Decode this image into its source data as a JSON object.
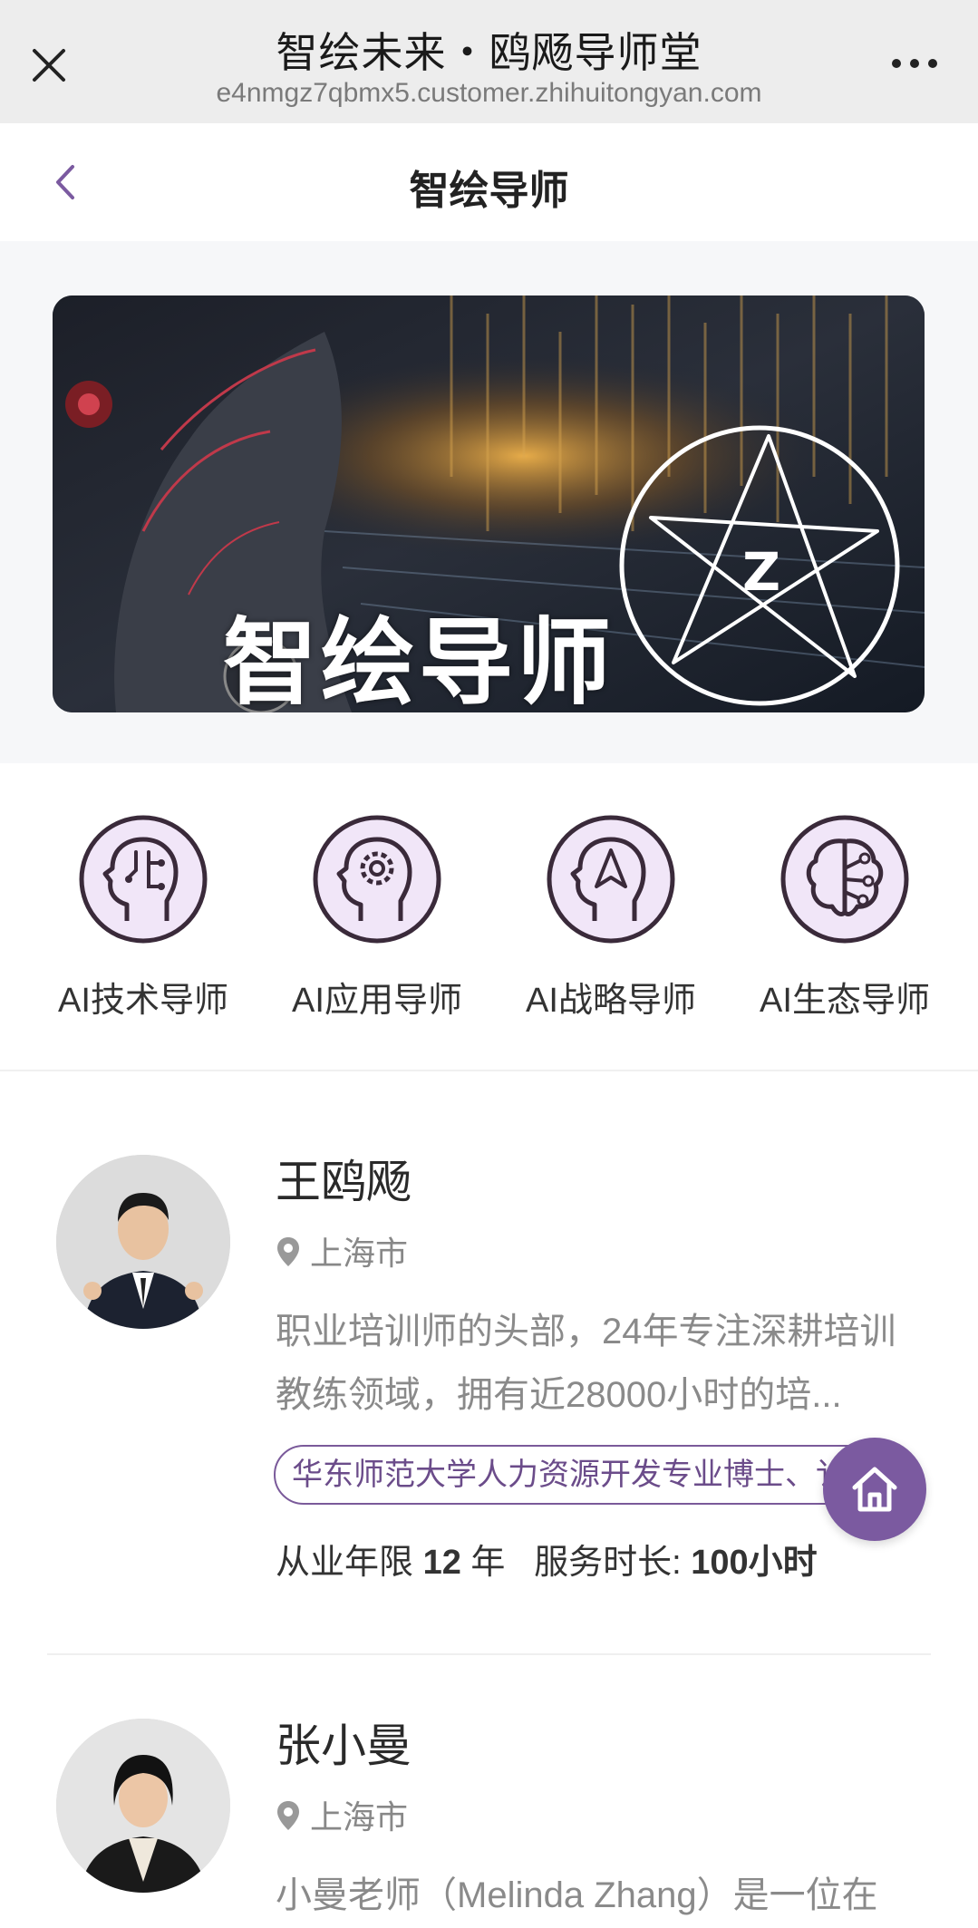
{
  "browser": {
    "title": "智绘未来・鸥飏导师堂",
    "url": "e4nmgz7qbmx5.customer.zhihuitongyan.com",
    "close_icon": "close-icon",
    "more_icon": "more-icon"
  },
  "header": {
    "title": "智绘导师",
    "back_icon": "chevron-left-icon"
  },
  "banner": {
    "text": "智绘导师",
    "logo_letter": "Z"
  },
  "categories": [
    {
      "label": "AI技术导师",
      "icon": "head-circuit-icon"
    },
    {
      "label": "AI应用导师",
      "icon": "head-gear-icon"
    },
    {
      "label": "AI战略导师",
      "icon": "head-navigation-icon"
    },
    {
      "label": "AI生态导师",
      "icon": "brain-network-icon"
    }
  ],
  "tutors": [
    {
      "name": "王鸥飏",
      "location": "上海市",
      "description": "职业培训师的头部，24年专注深耕培训教练领域，拥有近28000小时的培...",
      "tag": "华东师范大学人力资源开发专业博士、讠",
      "years_label": "从业年限",
      "years_value": "12",
      "years_unit": "年",
      "hours_label": "服务时长:",
      "hours_value": "100小时"
    },
    {
      "name": "张小曼",
      "location": "上海市",
      "description": "小曼老师（Melinda Zhang）是一位在"
    }
  ],
  "colors": {
    "accent": "#7b5aa0",
    "category_fill": "#f1e6f8",
    "category_stroke": "#3a2a3a"
  },
  "fab": {
    "icon": "home-icon"
  }
}
